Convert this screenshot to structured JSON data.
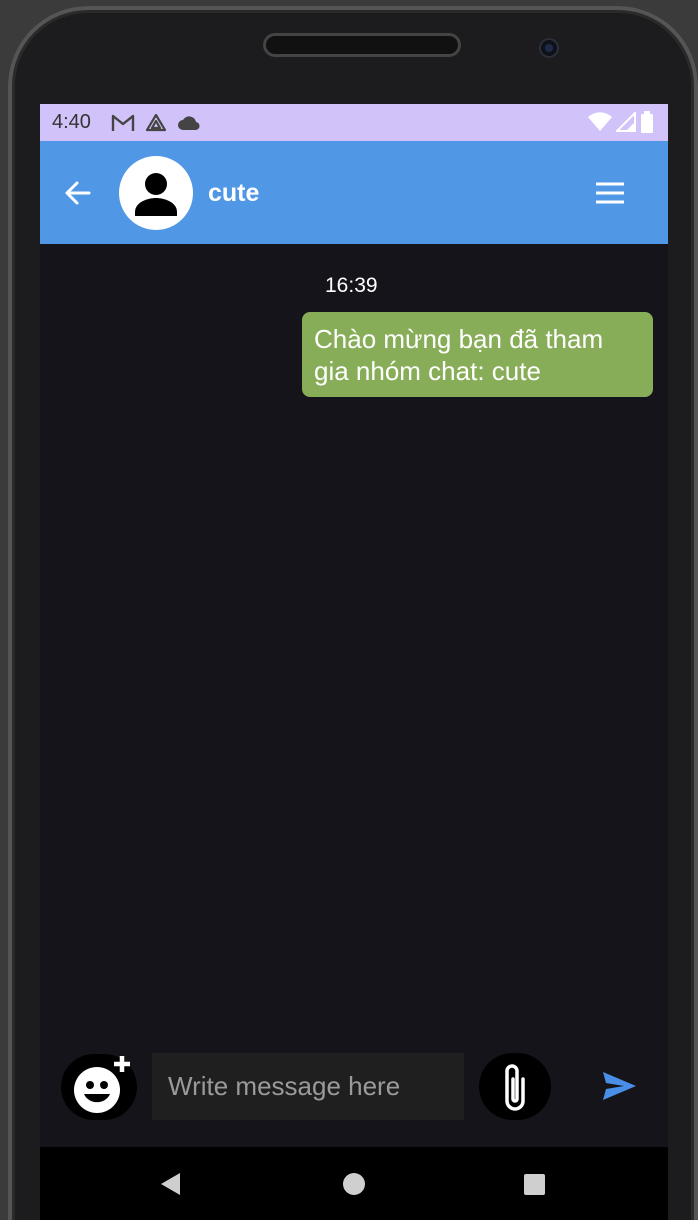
{
  "status_bar": {
    "time": "4:40",
    "icons": [
      "gmail-icon",
      "drive-icon",
      "cloud-icon",
      "wifi-icon",
      "signal-icon",
      "battery-icon"
    ],
    "background": "#d1c3f9"
  },
  "app_bar": {
    "title": "cute",
    "background": "#5097e6",
    "back_icon": "arrow-left-icon",
    "menu_icon": "hamburger-menu-icon"
  },
  "messages": {
    "timestamp": "16:39",
    "items": [
      {
        "text": "Chào mừng bạn đã tham gia nhóm chat: cute",
        "outgoing": true,
        "color": "#87ad58"
      }
    ]
  },
  "composer": {
    "placeholder": "Write message here",
    "emoji_icon": "emoji-add-icon",
    "attach_icon": "paperclip-icon",
    "send_icon": "send-icon",
    "send_color": "#4a8fe7"
  },
  "nav_bar": {
    "icons": [
      "back-triangle-icon",
      "home-circle-icon",
      "recents-square-icon"
    ]
  }
}
